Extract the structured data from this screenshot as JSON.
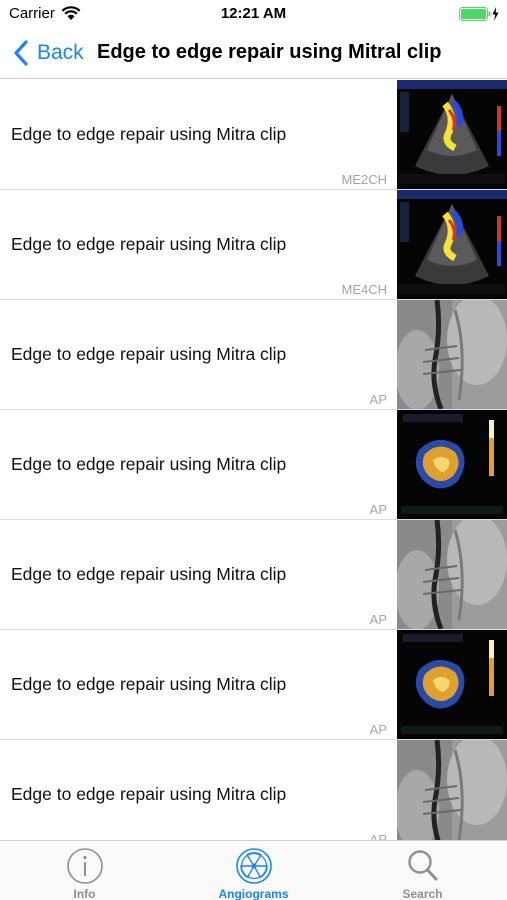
{
  "status_bar": {
    "carrier": "Carrier",
    "time": "12:21 AM",
    "battery_color": "#4cd964"
  },
  "nav": {
    "back_label": "Back",
    "title": "Edge to edge repair using Mitral clip",
    "accent_color": "#1a84ff"
  },
  "rows": [
    {
      "title": "Edge to edge repair using Mitra clip",
      "view": "ME2CH",
      "thumbnail": "tee-color-doppler"
    },
    {
      "title": "Edge to edge repair using Mitra clip",
      "view": "ME4CH",
      "thumbnail": "tee-color-doppler"
    },
    {
      "title": "Edge to edge repair using Mitra clip",
      "view": "AP",
      "thumbnail": "fluoroscopy"
    },
    {
      "title": "Edge to edge repair using Mitra clip",
      "view": "AP",
      "thumbnail": "3d-echo"
    },
    {
      "title": "Edge to edge repair using Mitra clip",
      "view": "AP",
      "thumbnail": "fluoroscopy"
    },
    {
      "title": "Edge to edge repair using Mitra clip",
      "view": "AP",
      "thumbnail": "3d-echo"
    },
    {
      "title": "Edge to edge repair using Mitra clip",
      "view": "AP",
      "thumbnail": "fluoroscopy"
    }
  ],
  "tabs": [
    {
      "label": "Info",
      "icon": "info-icon",
      "active": false
    },
    {
      "label": "Angiograms",
      "icon": "radiation-icon",
      "active": true
    },
    {
      "label": "Search",
      "icon": "search-icon",
      "active": false
    }
  ]
}
